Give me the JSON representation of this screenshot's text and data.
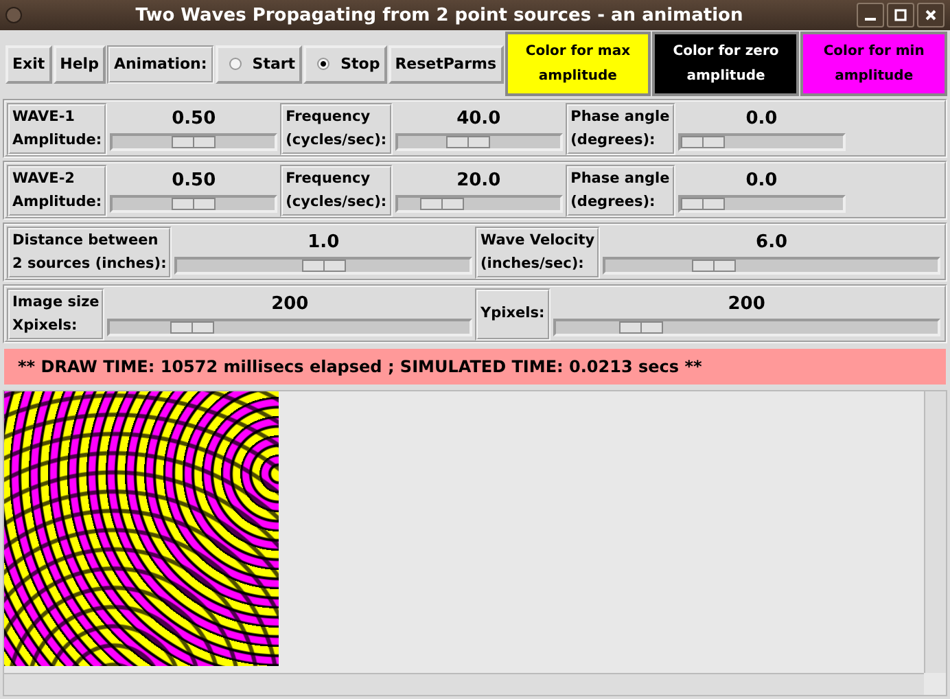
{
  "window": {
    "title": "Two Waves Propagating from 2 point sources - an animation"
  },
  "toolbar": [
    {
      "kind": "button",
      "label": "Exit"
    },
    {
      "kind": "button",
      "label": "Help"
    },
    {
      "kind": "label",
      "label": "Animation:"
    },
    {
      "kind": "radio",
      "label": "Start",
      "selected": false
    },
    {
      "kind": "radio",
      "label": "Stop",
      "selected": true
    },
    {
      "kind": "button",
      "label": "ResetParms"
    },
    {
      "kind": "color",
      "label": "Color for max amplitude",
      "color": "#ffff00"
    },
    {
      "kind": "color",
      "label": "Color for zero amplitude",
      "color": "#000000"
    },
    {
      "kind": "color",
      "label": "Color for min amplitude",
      "color": "#ff00ff"
    }
  ],
  "rows": [
    {
      "kind": "fixed",
      "controls": [
        {
          "label": [
            "WAVE-1",
            "Amplitude:"
          ],
          "value": "0.50",
          "level": 0.5
        },
        {
          "label": [
            "Frequency",
            "(cycles/sec):"
          ],
          "value": "40.0",
          "level": 0.41
        },
        {
          "label": [
            "Phase angle",
            "(degrees):"
          ],
          "value": "0.0",
          "level": 0
        }
      ]
    },
    {
      "kind": "fixed",
      "controls": [
        {
          "label": [
            "WAVE-2",
            "Amplitude:"
          ],
          "value": "0.50",
          "level": 0.5
        },
        {
          "label": [
            "Frequency",
            "(cycles/sec):"
          ],
          "value": "20.0",
          "level": 0.19
        },
        {
          "label": [
            "Phase angle",
            "(degrees):"
          ],
          "value": "0.0",
          "level": 0
        }
      ]
    },
    {
      "kind": "wide",
      "controls": [
        {
          "label": [
            "Distance between",
            "2 sources (inches):"
          ],
          "value": "1.0",
          "level": 0.5
        },
        {
          "label": [
            "Wave Velocity",
            "(inches/sec):"
          ],
          "value": "6.0",
          "level": 0.3
        }
      ]
    },
    {
      "kind": "wide",
      "controls": [
        {
          "label": [
            "Image size",
            "Xpixels:"
          ],
          "value": "200",
          "level": 0.19
        },
        {
          "label": [
            "Ypixels:"
          ],
          "value": "200",
          "level": 0.19
        }
      ]
    }
  ],
  "status": "** DRAW TIME: 10572 millisecs elapsed ; SIMULATED TIME: 0.0213 secs **"
}
